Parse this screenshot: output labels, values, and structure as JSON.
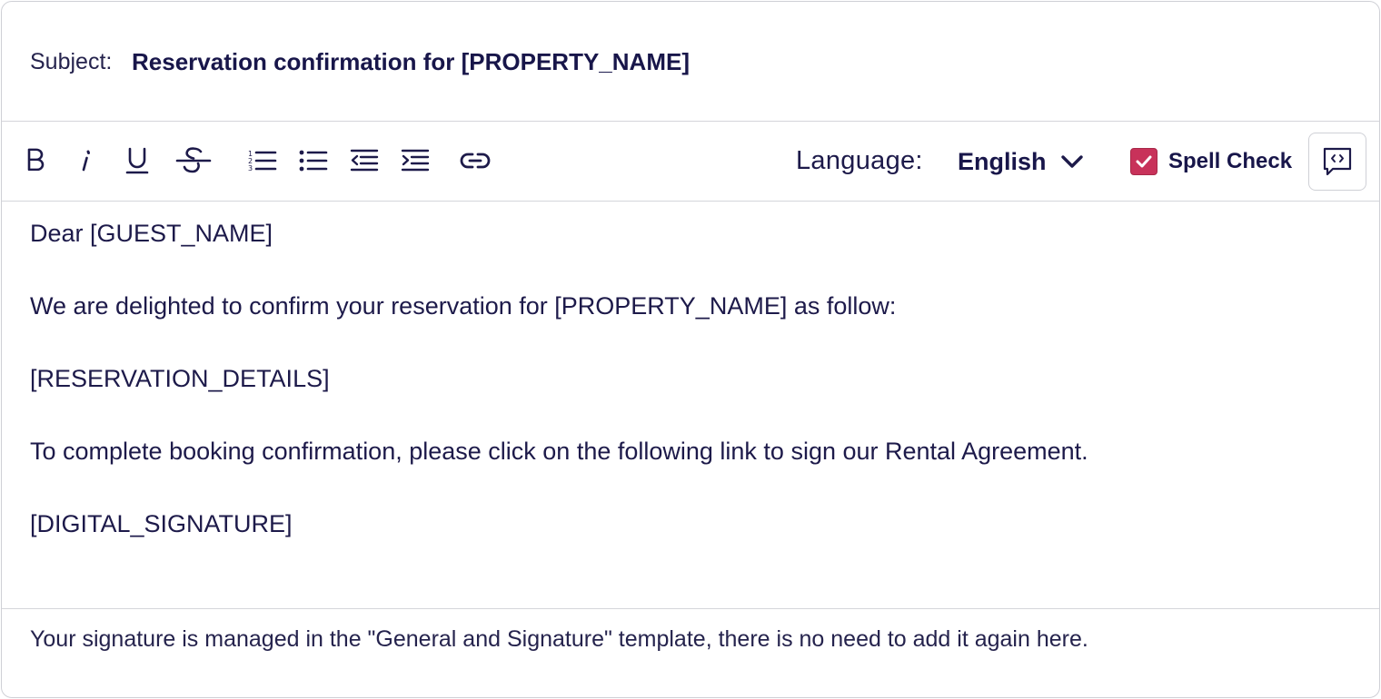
{
  "subject": {
    "label": "Subject:",
    "value": "Reservation confirmation for [PROPERTY_NAME]"
  },
  "toolbar": {
    "format_buttons": [
      {
        "name": "bold-button",
        "icon": "bold-icon"
      },
      {
        "name": "italic-button",
        "icon": "italic-icon"
      },
      {
        "name": "underline-button",
        "icon": "underline-icon"
      },
      {
        "name": "strikethrough-button",
        "icon": "strikethrough-icon"
      },
      {
        "name": "ordered-list-button",
        "icon": "ordered-list-icon"
      },
      {
        "name": "bullet-list-button",
        "icon": "bullet-list-icon"
      },
      {
        "name": "outdent-button",
        "icon": "outdent-icon"
      },
      {
        "name": "indent-button",
        "icon": "indent-icon"
      },
      {
        "name": "link-button",
        "icon": "link-icon"
      }
    ],
    "language_label": "Language:",
    "language_value": "English",
    "spell_check_label": "Spell Check",
    "spell_check_checked": true,
    "source_button_icon": "code-view-icon"
  },
  "body": {
    "paragraphs": [
      "Dear [GUEST_NAME]",
      "We are delighted to confirm your reservation for [PROPERTY_NAME] as follow:",
      "[RESERVATION_DETAILS]",
      "To complete booking confirmation, please click on the following link to sign our Rental Agreement.",
      "[DIGITAL_SIGNATURE]"
    ]
  },
  "footer_note": "Your signature is managed in the \"General and Signature\" template, there is no need to add it again here.",
  "colors": {
    "text": "#1d1a4a",
    "accent_checkbox": "#c8325a",
    "border": "#cfd0d6"
  }
}
